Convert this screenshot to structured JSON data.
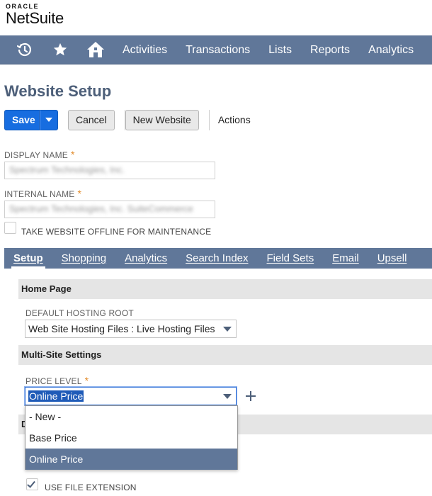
{
  "logo": {
    "oracle": "ORACLE",
    "product": "NetSuite"
  },
  "nav": {
    "items": [
      "Activities",
      "Transactions",
      "Lists",
      "Reports",
      "Analytics"
    ]
  },
  "page": {
    "title": "Website Setup"
  },
  "toolbar": {
    "save_label": "Save",
    "cancel_label": "Cancel",
    "new_website_label": "New Website",
    "actions_label": "Actions"
  },
  "fields": {
    "display_name": {
      "label": "DISPLAY NAME",
      "required": "*",
      "value": "Spectrum Technologies, Inc."
    },
    "internal_name": {
      "label": "INTERNAL NAME",
      "required": "*",
      "value": "Spectrum Technologies, Inc. SuiteCommerce"
    },
    "take_offline": {
      "label": "TAKE WEBSITE OFFLINE FOR MAINTENANCE",
      "checked": false
    }
  },
  "tabs": [
    "Setup",
    "Shopping",
    "Analytics",
    "Search Index",
    "Field Sets",
    "Email",
    "Upsell"
  ],
  "active_tab": "Setup",
  "sections": {
    "home_page": {
      "title": "Home Page",
      "hosting_root_label": "DEFAULT HOSTING ROOT",
      "hosting_root_value": "Web Site Hosting Files : Live Hosting Files"
    },
    "multi_site": {
      "title": "Multi-Site Settings",
      "price_level_label": "PRICE LEVEL",
      "required": "*",
      "price_level_value": "Online Price"
    },
    "partial_section_initial": "D"
  },
  "price_level_dropdown": {
    "options": [
      "- New -",
      "Base Price",
      "Online Price"
    ],
    "selected": "Online Price"
  },
  "bottom_checkbox": {
    "label": "USE FILE EXTENSION",
    "checked": true
  },
  "colors": {
    "nav_bg": "#607799",
    "title": "#4d5f79",
    "save_button": "#176de0",
    "required_star": "#e28b2a",
    "section_bg": "#e5e5e5"
  }
}
